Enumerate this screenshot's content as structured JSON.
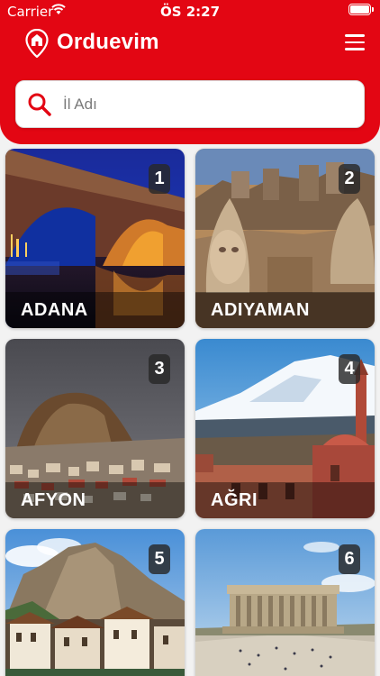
{
  "status_bar": {
    "carrier": "Carrier",
    "time": "ÖS 2:27"
  },
  "header": {
    "title": "Orduevim",
    "logo_icon": "location-pin-icon",
    "menu_icon": "hamburger-menu-icon"
  },
  "search": {
    "placeholder": "İl Adı",
    "value": ""
  },
  "colors": {
    "brand_red": "#e30613"
  },
  "provinces": [
    {
      "number": "1",
      "name": "ADANA"
    },
    {
      "number": "2",
      "name": "ADIYAMAN"
    },
    {
      "number": "3",
      "name": "AFYON"
    },
    {
      "number": "4",
      "name": "AĞRI"
    },
    {
      "number": "5",
      "name": ""
    },
    {
      "number": "6",
      "name": ""
    }
  ]
}
